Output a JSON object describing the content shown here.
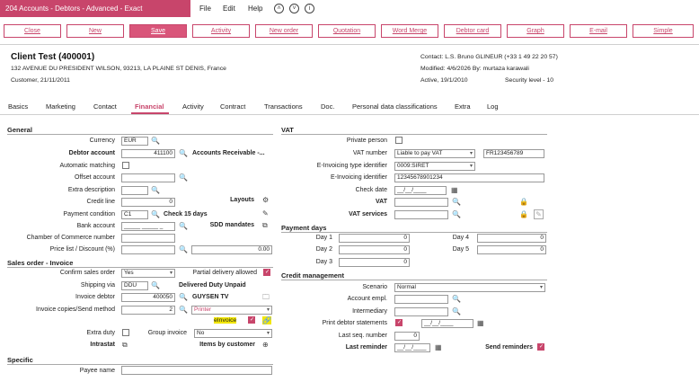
{
  "window": {
    "title": "204 Accounts - Debtors - Advanced - Exact"
  },
  "menu": {
    "file": "File",
    "edit": "Edit",
    "help": "Help"
  },
  "toolbar": {
    "close": "Close",
    "new": "New",
    "save": "Save",
    "activity": "Activity",
    "new_order": "New order",
    "quotation": "Quotation",
    "word_merge": "Word Merge",
    "debtor_card": "Debtor card",
    "graph": "Graph",
    "email": "E-mail",
    "simple": "Simple"
  },
  "header": {
    "client": "Client Test (400001)",
    "address": "132 AVENUE DU PRESIDENT WILSON, 93213, LA PLAINE ST DENIS, France",
    "customer": "Customer, 21/11/2011",
    "contact": "Contact: L.S. Bruno GLINEUR (+33 1 49 22 20 57)",
    "modified": "Modified: 4/6/2026 By: murtaza karawali",
    "active": "Active, 19/1/2010",
    "security": "Security level - 10"
  },
  "tabs": [
    "Basics",
    "Marketing",
    "Contact",
    "Financial",
    "Activity",
    "Contract",
    "Transactions",
    "Doc.",
    "Personal data classifications",
    "Extra",
    "Log"
  ],
  "general": {
    "title": "General",
    "currency_label": "Currency",
    "currency": "EUR",
    "debtor_account_label": "Debtor account",
    "debtor_account": "411100",
    "debtor_account_desc": "Accounts Receivable -...",
    "auto_matching_label": "Automatic matching",
    "offset_account_label": "Offset account",
    "extra_description_label": "Extra description",
    "credit_line_label": "Credit line",
    "credit_line": "0",
    "layouts_label": "Layouts",
    "payment_condition_label": "Payment condition",
    "payment_condition": "C1",
    "payment_condition_desc": "Check 15 days",
    "bank_account_label": "Bank account",
    "bank_account": "_____ _____ _",
    "sdd_mandates_label": "SDD mandates",
    "coc_label": "Chamber of Commerce number",
    "price_list_label": "Price list / Discount (%)",
    "discount": "0.00"
  },
  "sales": {
    "title": "Sales order - Invoice",
    "confirm_label": "Confirm sales order",
    "confirm": "Yes",
    "partial_label": "Partial delivery allowed",
    "shipping_label": "Shipping via",
    "shipping": "DDU",
    "shipping_desc": "Delivered Duty Unpaid",
    "invoice_debtor_label": "Invoice debtor",
    "invoice_debtor": "400050",
    "invoice_debtor_desc": "GUYSEN TV",
    "copies_label": "Invoice copies/Send method",
    "copies": "2",
    "send_method": "Printer",
    "einvoice_label": "eInvoice",
    "extra_duty_label": "Extra duty",
    "group_invoice_label": "Group invoice",
    "group_invoice": "No",
    "intrastat_label": "Intrastat",
    "items_by_customer_label": "Items by customer"
  },
  "specific": {
    "title": "Specific",
    "payee_label": "Payee name"
  },
  "vat": {
    "title": "VAT",
    "private_label": "Private person",
    "vat_number_label": "VAT number",
    "vat_liability": "Liable to pay VAT",
    "vat_number": "FR123456789",
    "einv_type_label": "E-Invoicing type identifier",
    "einv_type": "0009:SIRET",
    "einv_id_label": "E-Invoicing identifier",
    "einv_id": "12345678901234",
    "check_date_label": "Check date",
    "check_date": "__/__/____",
    "vat_label": "VAT",
    "vat_services_label": "VAT services"
  },
  "payment_days": {
    "title": "Payment days",
    "day1_label": "Day 1",
    "day1": "0",
    "day2_label": "Day 2",
    "day2": "0",
    "day3_label": "Day 3",
    "day3": "0",
    "day4_label": "Day 4",
    "day4": "0",
    "day5_label": "Day 5",
    "day5": "0"
  },
  "credit": {
    "title": "Credit management",
    "scenario_label": "Scenario",
    "scenario": "Normal",
    "account_empl_label": "Account empl.",
    "intermediary_label": "Intermediary",
    "print_statements_label": "Print debtor statements",
    "print_statements_date": "__/__/____",
    "last_seq_label": "Last seq. number",
    "last_seq": "0",
    "last_reminder_label": "Last reminder",
    "last_reminder": "__/__/____",
    "send_reminders_label": "Send reminders"
  },
  "colors": {
    "brand": "#c8456b",
    "highlight": "#f2e600"
  }
}
